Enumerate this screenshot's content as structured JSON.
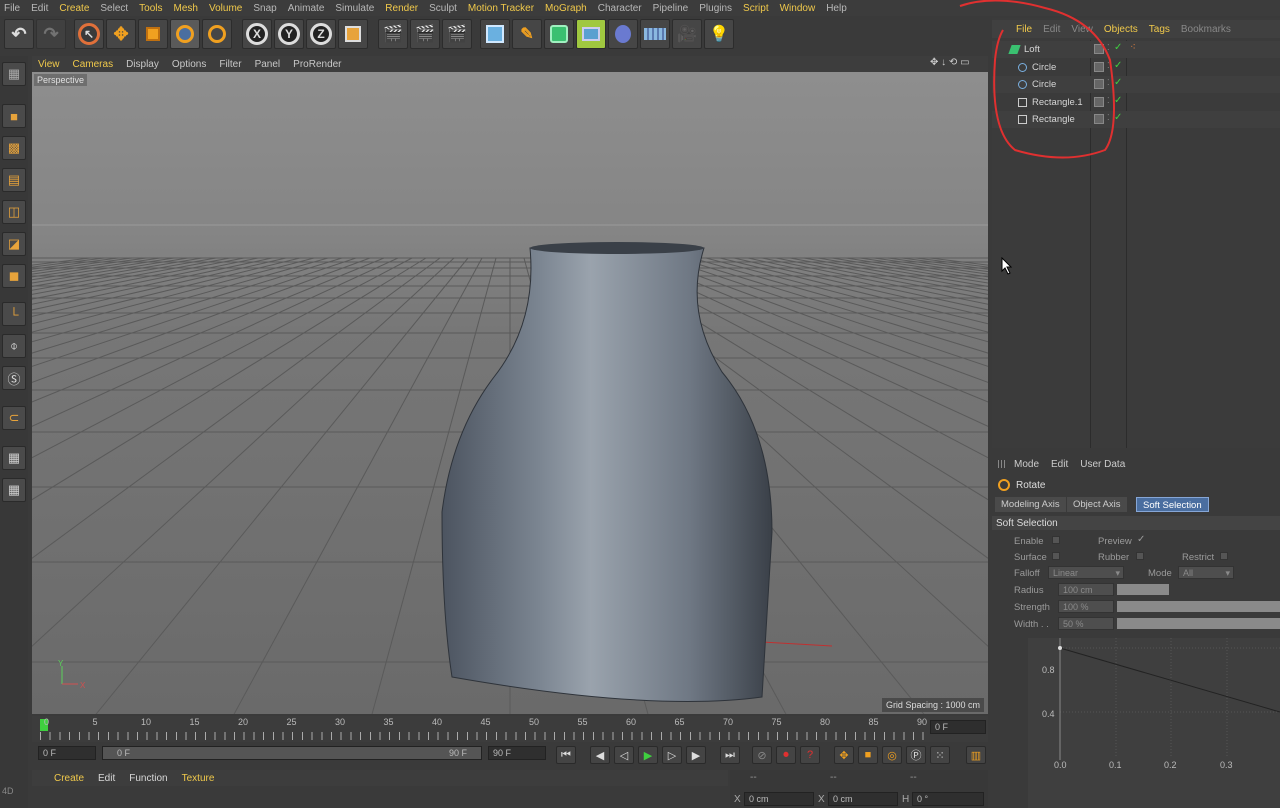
{
  "menubar": [
    "File",
    "Edit",
    "Create",
    "Select",
    "Tools",
    "Mesh",
    "Volume",
    "Snap",
    "Animate",
    "Simulate",
    "Render",
    "Sculpt",
    "Motion Tracker",
    "MoGraph",
    "Character",
    "Pipeline",
    "Plugins",
    "Script",
    "Window",
    "Help"
  ],
  "menubar_highlight": [
    "Create",
    "Tools",
    "Mesh",
    "Volume",
    "Render",
    "Motion Tracker",
    "MoGraph",
    "Script",
    "Window"
  ],
  "toolbar": {
    "axis_x": "X",
    "axis_y": "Y",
    "axis_z": "Z"
  },
  "viewport_menu": [
    "View",
    "Cameras",
    "Display",
    "Options",
    "Filter",
    "Panel",
    "ProRender"
  ],
  "viewport": {
    "label": "Perspective",
    "grid_spacing": "Grid Spacing : 1000 cm",
    "axis_y": "Y",
    "axis_x": "X"
  },
  "timeline": {
    "ticks": [
      "0",
      "5",
      "10",
      "15",
      "20",
      "25",
      "30",
      "35",
      "40",
      "45",
      "50",
      "55",
      "60",
      "65",
      "70",
      "75",
      "80",
      "85",
      "90"
    ],
    "current_frame": "0 F",
    "start_field": "0 F",
    "range_start": "0 F",
    "range_end": "90 F",
    "end_field": "90 F"
  },
  "material_menu": [
    "Create",
    "Edit",
    "Function",
    "Texture"
  ],
  "coords": {
    "header": [
      "--",
      "--",
      "--"
    ],
    "x_label": "X",
    "x_value": "0 cm",
    "x2_label": "X",
    "x2_value": "0 cm",
    "h_label": "H",
    "h_value": "0 °"
  },
  "object_manager": {
    "menu": [
      "File",
      "Edit",
      "View",
      "Objects",
      "Tags",
      "Bookmarks"
    ],
    "menu_highlight": [
      "File",
      "Objects",
      "Tags"
    ],
    "objects": [
      {
        "name": "Loft",
        "icon": "loft-icon"
      },
      {
        "name": "Circle",
        "icon": "circle-spline-icon"
      },
      {
        "name": "Circle",
        "icon": "circle-spline-icon"
      },
      {
        "name": "Rectangle.1",
        "icon": "rectangle-spline-icon"
      },
      {
        "name": "Rectangle",
        "icon": "rectangle-spline-icon"
      }
    ]
  },
  "attribute_manager": {
    "menu": [
      "Mode",
      "Edit",
      "User Data"
    ],
    "tool_name": "Rotate",
    "tabs": [
      "Modeling Axis",
      "Object Axis",
      "Soft Selection"
    ],
    "active_tab": "Soft Selection",
    "section": "Soft Selection",
    "enable_label": "Enable",
    "preview_label": "Preview",
    "surface_label": "Surface",
    "rubber_label": "Rubber",
    "restrict_label": "Restrict",
    "falloff_label": "Falloff",
    "falloff_value": "Linear",
    "mode_label": "Mode",
    "mode_value": "All",
    "radius_label": "Radius",
    "radius_value": "100 cm",
    "strength_label": "Strength",
    "strength_value": "100 %",
    "width_label": "Width . .",
    "width_value": "50 %",
    "graph_y": [
      "0.8",
      "0.4"
    ],
    "graph_x": [
      "0.0",
      "0.1",
      "0.2",
      "0.3"
    ]
  },
  "side_label": "4D"
}
